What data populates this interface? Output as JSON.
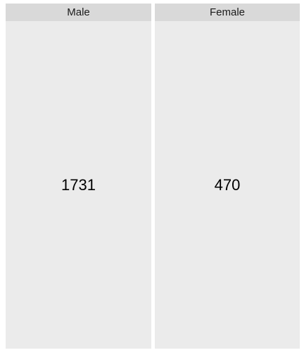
{
  "chart_data": {
    "type": "table",
    "panels": [
      {
        "label": "Male",
        "value": 1731
      },
      {
        "label": "Female",
        "value": 470
      }
    ],
    "title": "",
    "xlabel": "",
    "ylabel": ""
  },
  "colors": {
    "strip_background": "#d9d9d9",
    "panel_background": "#ebebeb",
    "text": "#000000"
  }
}
